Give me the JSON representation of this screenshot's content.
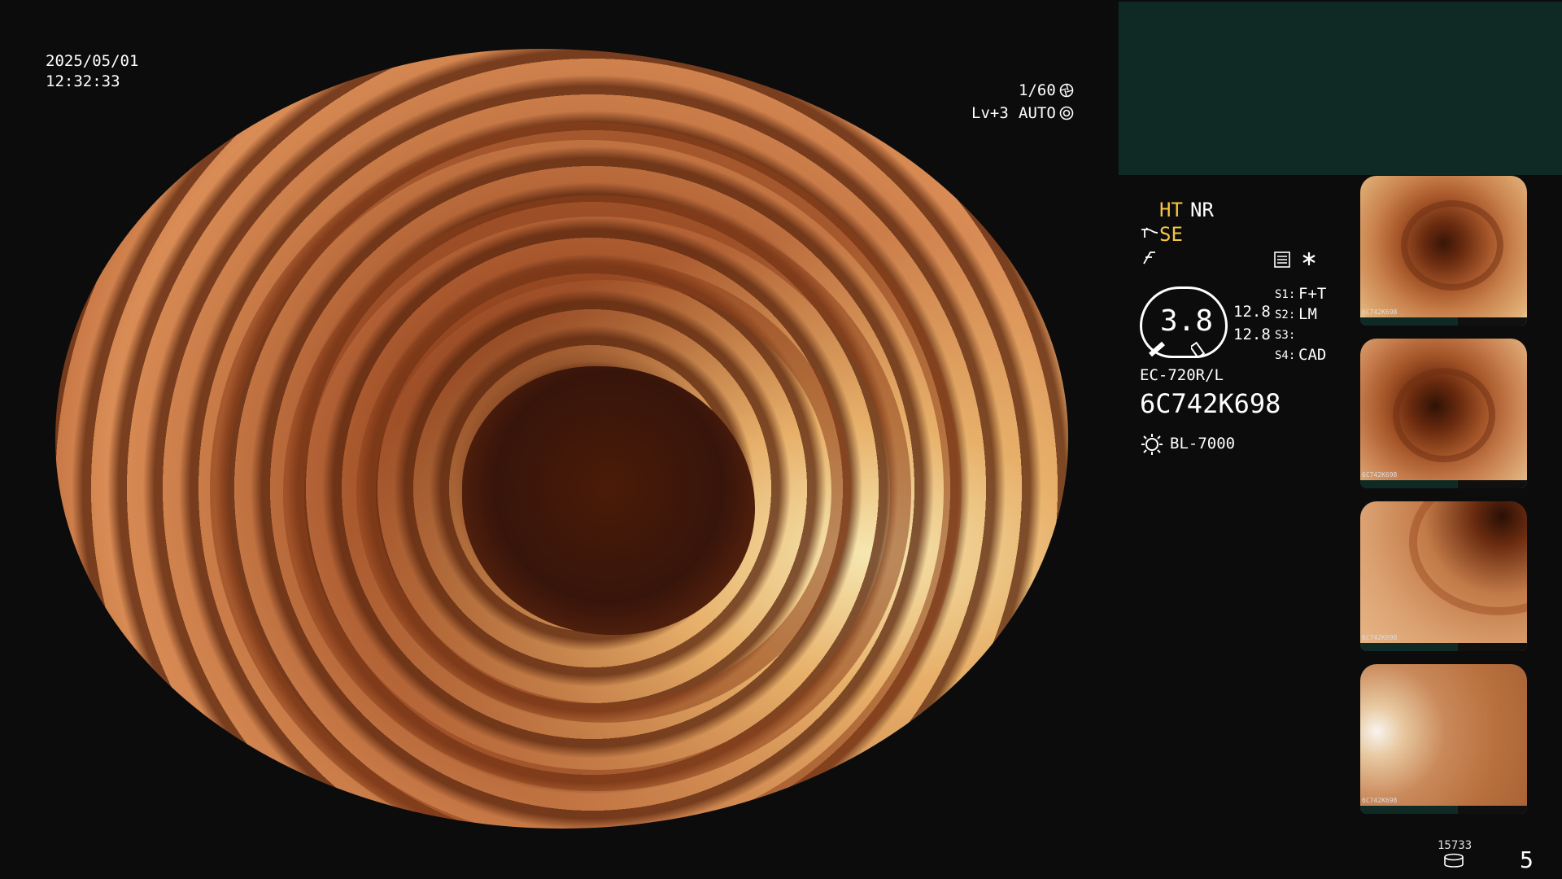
{
  "header": {
    "date": "2025/05/01",
    "time": "12:32:33"
  },
  "exposure": {
    "shutter": "1/60",
    "level": "Lv+3",
    "mode": "AUTO"
  },
  "processing": {
    "ht": "HT",
    "nr": "NR",
    "se": "SE"
  },
  "gauge": {
    "value": "3.8",
    "left_reading": "12.8",
    "right_reading": "12.8"
  },
  "switches": [
    {
      "label": "S1:",
      "value": "F+T"
    },
    {
      "label": "S2:",
      "value": "LM"
    },
    {
      "label": "S3:",
      "value": ""
    },
    {
      "label": "S4:",
      "value": "CAD"
    }
  ],
  "scope": {
    "model": "EC-720R/L",
    "serial": "6C742K698",
    "light_source": "BL-7000"
  },
  "footer": {
    "storage_count": "15733",
    "image_count": "5"
  },
  "thumbnails": [
    {
      "serial": "6C742K698"
    },
    {
      "serial": "6C742K698"
    },
    {
      "serial": "6C742K698"
    },
    {
      "serial": "6C742K698"
    }
  ],
  "colors": {
    "accent_yellow": "#f5c542",
    "panel_teal": "#0f2a24",
    "background": "#0c0c0c"
  },
  "icons": [
    "iris-icon",
    "auto-exposure-icon",
    "scope-knob-icon",
    "freeze-icon",
    "menu-settings-icon",
    "asterisk-icon",
    "light-source-icon",
    "storage-disk-icon"
  ]
}
